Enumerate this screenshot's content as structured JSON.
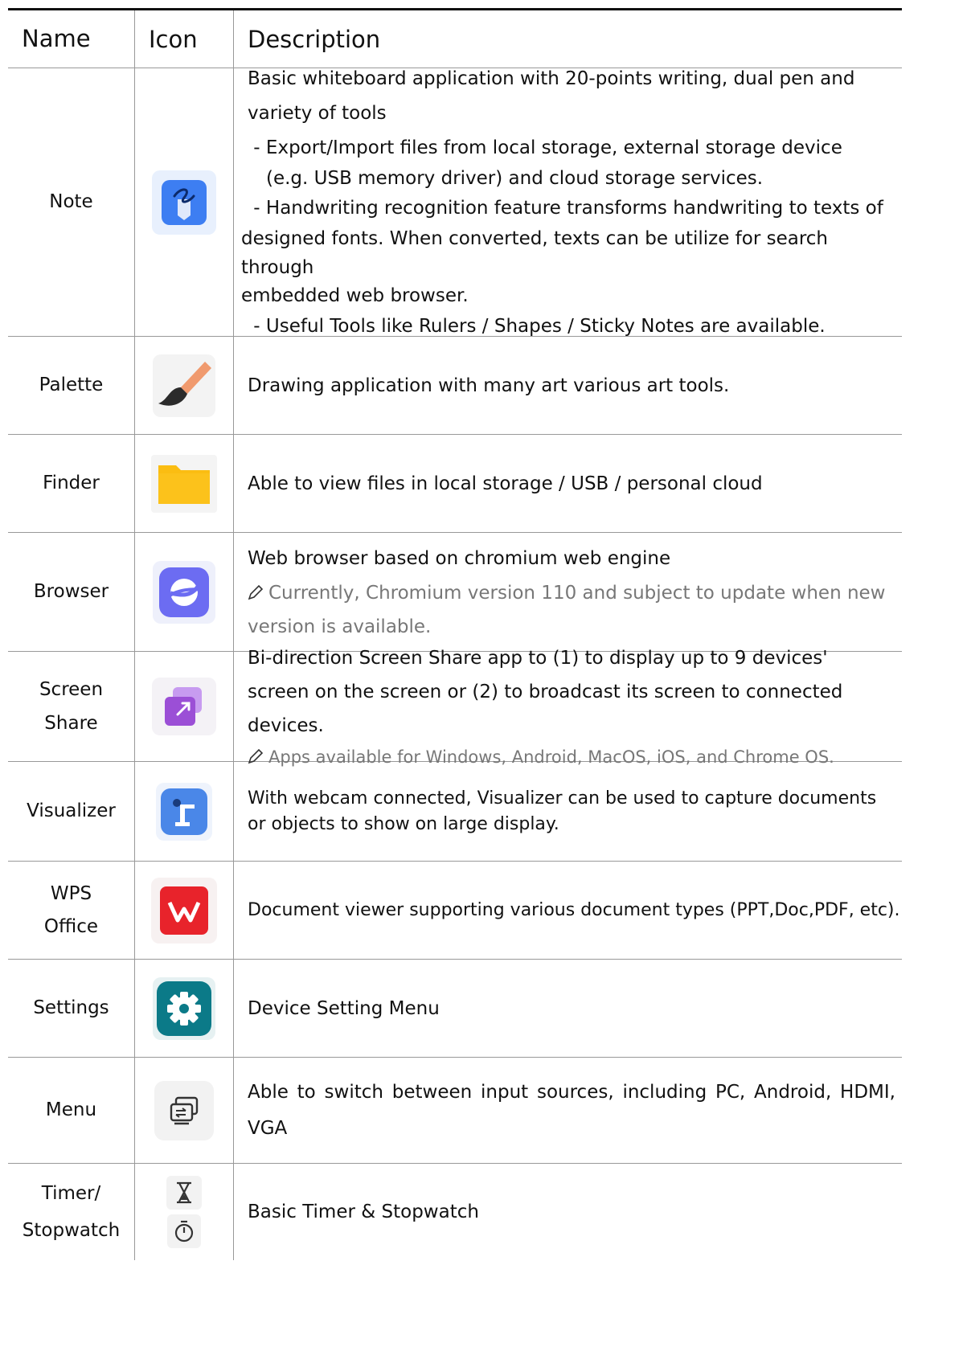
{
  "header": {
    "name": "Name",
    "icon": "Icon",
    "description": "Description"
  },
  "rows": [
    {
      "name": "Note",
      "icon": "note-pen-icon",
      "lines": [
        "Basic whiteboard application with 20-points writing, dual pen and",
        "variety of tools",
        " - Export/Import files from local storage, external storage device",
        "(e.g. USB memory driver) and cloud storage services.",
        " - Handwriting recognition feature transforms handwriting to texts of",
        "designed fonts. When converted, texts can be utilize for search through",
        "embedded web browser.",
        " - Useful Tools like Rulers / Shapes / Sticky Notes are available."
      ]
    },
    {
      "name": "Palette",
      "icon": "paintbrush-icon",
      "desc": "Drawing application with many art various art tools."
    },
    {
      "name": "Finder",
      "icon": "folder-icon",
      "desc": "Able to view files in local storage / USB / personal cloud"
    },
    {
      "name": "Browser",
      "icon": "planet-browser-icon",
      "desc": "Web browser based on chromium web engine",
      "note": "Currently, Chromium version 110 and subject to update when new version is available."
    },
    {
      "name_line1": "Screen",
      "name_line2": "Share",
      "icon": "screen-share-icon",
      "desc": "Bi-direction Screen Share app to (1) to display up to 9 devices' screen on the screen or (2) to broadcast its screen to connected devices.",
      "note": "Apps available for Windows, Android, MacOS, iOS, and Chrome OS."
    },
    {
      "name": "Visualizer",
      "icon": "visualizer-camera-icon",
      "desc": "With webcam connected, Visualizer can be used to capture documents or objects to show on large display."
    },
    {
      "name_line1": "WPS",
      "name_line2": "Office",
      "icon": "wps-office-icon",
      "desc": "Document viewer supporting various document types (PPT,Doc,PDF, etc)."
    },
    {
      "name": "Settings",
      "icon": "gear-icon",
      "desc": "Device Setting Menu"
    },
    {
      "name": "Menu",
      "icon": "input-source-icon",
      "desc": "Able to switch between input sources, including PC, Android, HDMI, VGA"
    },
    {
      "name_line1": "Timer/",
      "name_line2": "Stopwatch",
      "icon": "hourglass-icon, stopwatch-icon",
      "desc": "Basic Timer & Stopwatch"
    }
  ],
  "colors": {
    "note_icon": "#3d7ef2",
    "brush_tip": "#f09a6e",
    "folder": "#fbbd12",
    "browser_icon": "#6c6cf2",
    "screenshare_icon": "#9b4fd6",
    "visualizer_icon": "#4a87e8",
    "wps_red": "#e8232b",
    "settings_teal": "#0b7a88",
    "note_gray": "#777777"
  }
}
